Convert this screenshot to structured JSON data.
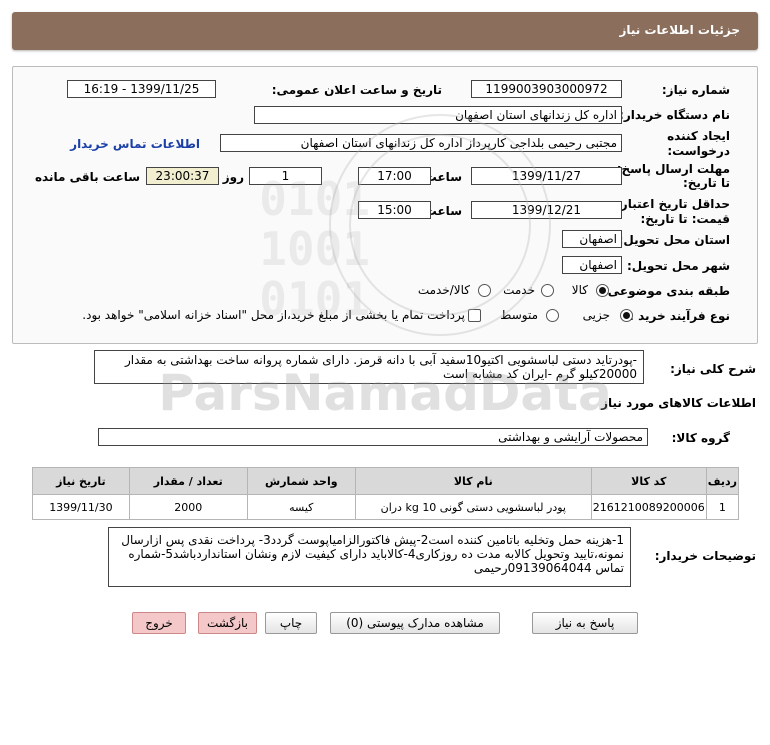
{
  "header": {
    "title": "جزئیات اطلاعات نیاز"
  },
  "fields": {
    "need_number_label": "شماره نیاز:",
    "need_number": "1199003903000972",
    "announce_label": "تاریخ و ساعت اعلان عمومی:",
    "announce_value": "1399/11/25 - 16:19",
    "buyer_label": "نام دستگاه خریدار:",
    "buyer_value": "اداره کل زندانهای استان اصفهان",
    "creator_label_1": "ایجاد کننده",
    "creator_label_2": "درخواست:",
    "creator_value": "مجتبی رحیمی بلداجی کارپرداز اداره کل زندانهای استان اصفهان",
    "contact_link": "اطلاعات تماس خریدار",
    "reply_deadline_label_1": "مهلت ارسال پاسخ:",
    "reply_deadline_label_2": "تا تاریخ:",
    "reply_date": "1399/11/27",
    "time_label": "ساعت",
    "reply_time": "17:00",
    "days_value": "1",
    "days_label": "روز و",
    "remaining_time": "23:00:37",
    "remaining_label": "ساعت باقی مانده",
    "validity_label_1": "حداقل تاریخ اعتبار",
    "validity_label_2": "قیمت: تا تاریخ:",
    "validity_date": "1399/12/21",
    "validity_time": "15:00",
    "province_label": "استان محل تحویل:",
    "province_value": "اصفهان",
    "city_label": "شهر محل تحویل:",
    "city_value": "اصفهان",
    "category_label": "طبقه بندی موضوعی:",
    "category_options": [
      "کالا",
      "خدمت",
      "کالا/خدمت"
    ],
    "purchase_label": "نوع فرآیند خرید :",
    "purchase_options": [
      "جزیی",
      "متوسط"
    ],
    "payment_note": "پرداخت تمام یا بخشی از مبلغ خرید،از محل \"اسناد خزانه اسلامی\" خواهد بود."
  },
  "summary": {
    "label": "شرح کلی نیاز:",
    "line1": "-پودرتاید دستی لباسشویی اکتیو10سفید آبی با دانه قرمز. دارای شماره پروانه ساخت بهداشتی به مقدار",
    "line2": "20000کیلو گرم -ایران کد مشابه است"
  },
  "goods_section": {
    "title": "اطلاعات کالاهای مورد نیاز"
  },
  "goods_group": {
    "label": "گروه کالا:",
    "value": "محصولات آرایشی و بهداشتی"
  },
  "table": {
    "headers": [
      "ردیف",
      "کد کالا",
      "نام کالا",
      "واحد شمارش",
      "تعداد / مقدار",
      "تاریخ نیاز"
    ],
    "rows": [
      [
        "1",
        "2161210089200006",
        "پودر لباسشویی دستی گونی 10 kg دران",
        "کیسه",
        "2000",
        "1399/11/30"
      ]
    ]
  },
  "buyer_notes": {
    "label": "توضیحات خریدار:",
    "line1": "1-هزینه حمل وتخلیه باتامین کننده است2-پیش فاکتورالزامیاپوست گردد3- پرداخت نقدی پس ازارسال",
    "line2": "نمونه،تایید وتحویل کالابه مدت ده روزکاری4-کالاباید دارای کیفیت لازم ونشان استانداردباشد5-شماره",
    "line3": "تماس 09139064044رحیمی"
  },
  "buttons": {
    "reply": "پاسخ به نیاز",
    "attachments": "مشاهده مدارک پیوستی (0)",
    "print": "چاپ",
    "back": "بازگشت",
    "exit": "خروج"
  },
  "watermark": {
    "brand": "ParsNamadData"
  }
}
